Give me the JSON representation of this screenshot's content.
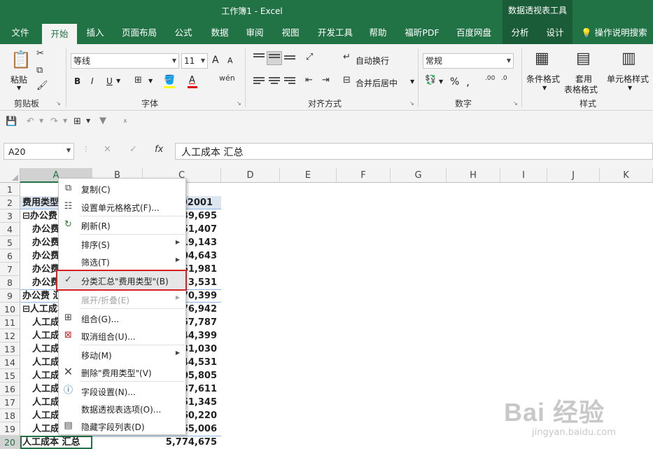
{
  "titlebar": {
    "title": "工作簿1  -  Excel",
    "context_title": "数据透视表工具"
  },
  "tabs": [
    "文件",
    "开始",
    "插入",
    "页面布局",
    "公式",
    "数据",
    "审阅",
    "视图",
    "开发工具",
    "帮助",
    "福昕PDF",
    "百度网盘",
    "分析",
    "设计"
  ],
  "tell_me": "操作说明搜索",
  "ribbon": {
    "clipboard": {
      "paste": "粘贴",
      "label": "剪贴板"
    },
    "font": {
      "name": "等线",
      "size": "11",
      "label": "字体",
      "bold": "B",
      "italic": "I",
      "underline": "U",
      "grow": "A",
      "shrink": "A",
      "color": "A"
    },
    "align": {
      "wrap": "自动换行",
      "merge": "合并后居中",
      "label": "对齐方式"
    },
    "number": {
      "format": "常规",
      "percent": "%",
      "label": "数字"
    },
    "styles": {
      "cond": "条件格式",
      "table1": "套用",
      "table2": "表格格式",
      "cell": "单元格样式",
      "label": "样式"
    }
  },
  "formula_bar": {
    "name_box": "A20",
    "fx": "fx",
    "content": "人工成本 汇总"
  },
  "columns": [
    "A",
    "B",
    "C",
    "D",
    "E",
    "F",
    "G",
    "H",
    "I",
    "J",
    "K"
  ],
  "rows": [
    "1",
    "2",
    "3",
    "4",
    "5",
    "6",
    "7",
    "8",
    "9",
    "10",
    "11",
    "12",
    "13",
    "14",
    "15",
    "16",
    "17",
    "18",
    "19",
    "20"
  ],
  "cells": {
    "a2": "费用类型",
    "c2": "202001",
    "a3": "⊟办公费",
    "a9": "办公费 汇总",
    "a10": "⊟人工成本",
    "a20": "人工成本 汇总",
    "sub_office": "办公费",
    "sub_labor": "人工成",
    "c_values": [
      "39,695",
      "51,407",
      "19,143",
      "04,643",
      "51,981",
      "3,531",
      "70,399",
      "76,942",
      "57,787",
      "44,399",
      "31,030",
      "44,531",
      "05,805",
      "37,611",
      "51,345",
      "60,220",
      "65,006",
      "5,774,675"
    ]
  },
  "context_menu": [
    {
      "label": "复制(C)",
      "icon": "copy-icon"
    },
    {
      "label": "设置单元格格式(F)...",
      "icon": "format-cells-icon"
    },
    {
      "label": "刷新(R)",
      "icon": "refresh-icon"
    },
    {
      "label": "排序(S)",
      "submenu": true
    },
    {
      "label": "筛选(T)",
      "submenu": true
    },
    {
      "label": "分类汇总\"费用类型\"(B)",
      "checked": true,
      "highlighted": true
    },
    {
      "label": "展开/折叠(E)",
      "submenu": true,
      "disabled": true
    },
    {
      "label": "组合(G)...",
      "icon": "group-icon"
    },
    {
      "label": "取消组合(U)...",
      "icon": "ungroup-icon"
    },
    {
      "label": "移动(M)",
      "submenu": true
    },
    {
      "label": "删除\"费用类型\"(V)",
      "icon": "delete-x-icon"
    },
    {
      "label": "字段设置(N)...",
      "icon": "field-settings-icon"
    },
    {
      "label": "数据透视表选项(O)..."
    },
    {
      "label": "隐藏字段列表(D)",
      "icon": "field-list-icon"
    }
  ],
  "watermark": {
    "big": "Bai 经验",
    "small": "jingyan.baidu.com"
  },
  "colors": {
    "excel_green": "#217346",
    "highlight_border": "#d62222",
    "pivot_header": "#dce6f1"
  }
}
